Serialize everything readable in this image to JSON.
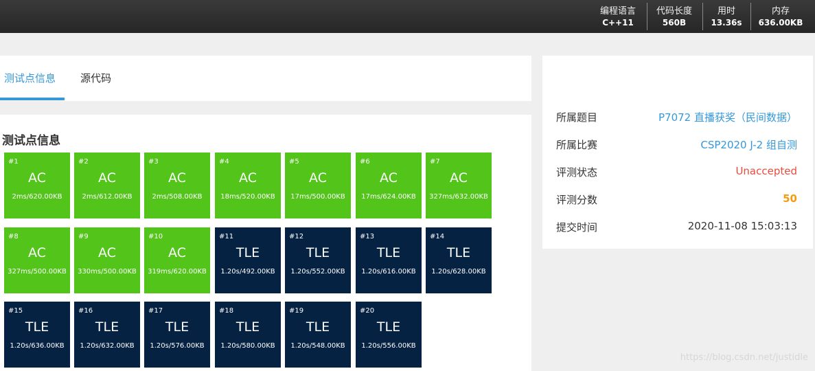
{
  "stats": [
    {
      "label": "编程语言",
      "value": "C++11"
    },
    {
      "label": "代码长度",
      "value": "560B"
    },
    {
      "label": "用时",
      "value": "13.36s"
    },
    {
      "label": "内存",
      "value": "636.00KB"
    }
  ],
  "tabs": [
    {
      "label": "测试点信息",
      "active": true
    },
    {
      "label": "源代码",
      "active": false
    }
  ],
  "section_title": "测试点信息",
  "colors": {
    "ac": "#52c41a",
    "tle": "#052242",
    "accent": "#3498db",
    "unaccepted": "#e74c3c",
    "score": "#f39c12"
  },
  "testcases": [
    {
      "num": "#1",
      "result": "AC",
      "detail": "2ms/620.00KB"
    },
    {
      "num": "#2",
      "result": "AC",
      "detail": "2ms/612.00KB"
    },
    {
      "num": "#3",
      "result": "AC",
      "detail": "2ms/508.00KB"
    },
    {
      "num": "#4",
      "result": "AC",
      "detail": "18ms/520.00KB"
    },
    {
      "num": "#5",
      "result": "AC",
      "detail": "17ms/500.00KB"
    },
    {
      "num": "#6",
      "result": "AC",
      "detail": "17ms/624.00KB"
    },
    {
      "num": "#7",
      "result": "AC",
      "detail": "327ms/632.00KB"
    },
    {
      "num": "#8",
      "result": "AC",
      "detail": "327ms/500.00KB"
    },
    {
      "num": "#9",
      "result": "AC",
      "detail": "330ms/500.00KB"
    },
    {
      "num": "#10",
      "result": "AC",
      "detail": "319ms/620.00KB"
    },
    {
      "num": "#11",
      "result": "TLE",
      "detail": "1.20s/492.00KB"
    },
    {
      "num": "#12",
      "result": "TLE",
      "detail": "1.20s/552.00KB"
    },
    {
      "num": "#13",
      "result": "TLE",
      "detail": "1.20s/616.00KB"
    },
    {
      "num": "#14",
      "result": "TLE",
      "detail": "1.20s/628.00KB"
    },
    {
      "num": "#15",
      "result": "TLE",
      "detail": "1.20s/636.00KB"
    },
    {
      "num": "#16",
      "result": "TLE",
      "detail": "1.20s/632.00KB"
    },
    {
      "num": "#17",
      "result": "TLE",
      "detail": "1.20s/576.00KB"
    },
    {
      "num": "#18",
      "result": "TLE",
      "detail": "1.20s/580.00KB"
    },
    {
      "num": "#19",
      "result": "TLE",
      "detail": "1.20s/548.00KB"
    },
    {
      "num": "#20",
      "result": "TLE",
      "detail": "1.20s/556.00KB"
    }
  ],
  "info": {
    "problem": {
      "label": "所属题目",
      "value": "P7072 直播获奖（民间数据）"
    },
    "contest": {
      "label": "所属比赛",
      "value": "CSP2020 J-2 组自测"
    },
    "status": {
      "label": "评测状态",
      "value": "Unaccepted"
    },
    "score": {
      "label": "评测分数",
      "value": "50"
    },
    "time": {
      "label": "提交时间",
      "value": "2020-11-08 15:03:13"
    }
  },
  "watermark": "https://blog.csdn.net/justidle"
}
